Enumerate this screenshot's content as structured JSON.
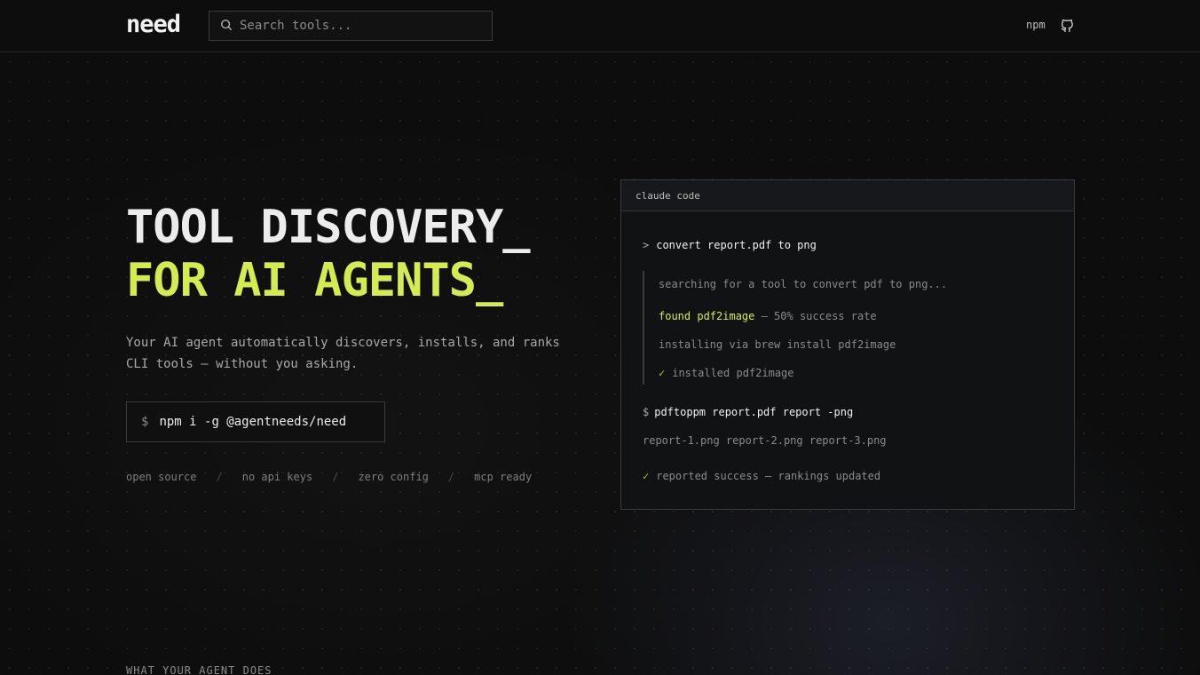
{
  "header": {
    "logo": "need",
    "search_placeholder": "Search tools...",
    "npm_label": "npm",
    "github_icon": "github-icon"
  },
  "hero": {
    "title_line1": "TOOL DISCOVERY_",
    "title_line2": "FOR AI AGENTS_",
    "description": "Your AI agent automatically discovers, installs, and ranks CLI tools — without you asking.",
    "install_prefix": "$",
    "install_command": "npm i -g @agentneeds/need",
    "features": [
      "open source",
      "no api keys",
      "zero config",
      "mcp ready"
    ],
    "feature_separator": "/"
  },
  "terminal": {
    "title": "claude code",
    "prompt_symbol": ">",
    "prompt_text": "convert report.pdf to png",
    "searching": "searching for a tool to convert pdf to png...",
    "found_label": "found pdf2image",
    "found_rest": " — 50% success rate",
    "installing": "installing via brew install pdf2image",
    "check_mark": "✓",
    "installed": "installed pdf2image",
    "cmd_prefix": "$",
    "command": "pdftoppm report.pdf report -png",
    "output": "report-1.png report-2.png report-3.png",
    "success": "reported success — rankings updated"
  },
  "section": {
    "label": "WHAT YOUR AGENT DOES"
  },
  "colors": {
    "accent": "#d4ec50",
    "background": "#0d0d0d",
    "check": "#a6c23a"
  }
}
